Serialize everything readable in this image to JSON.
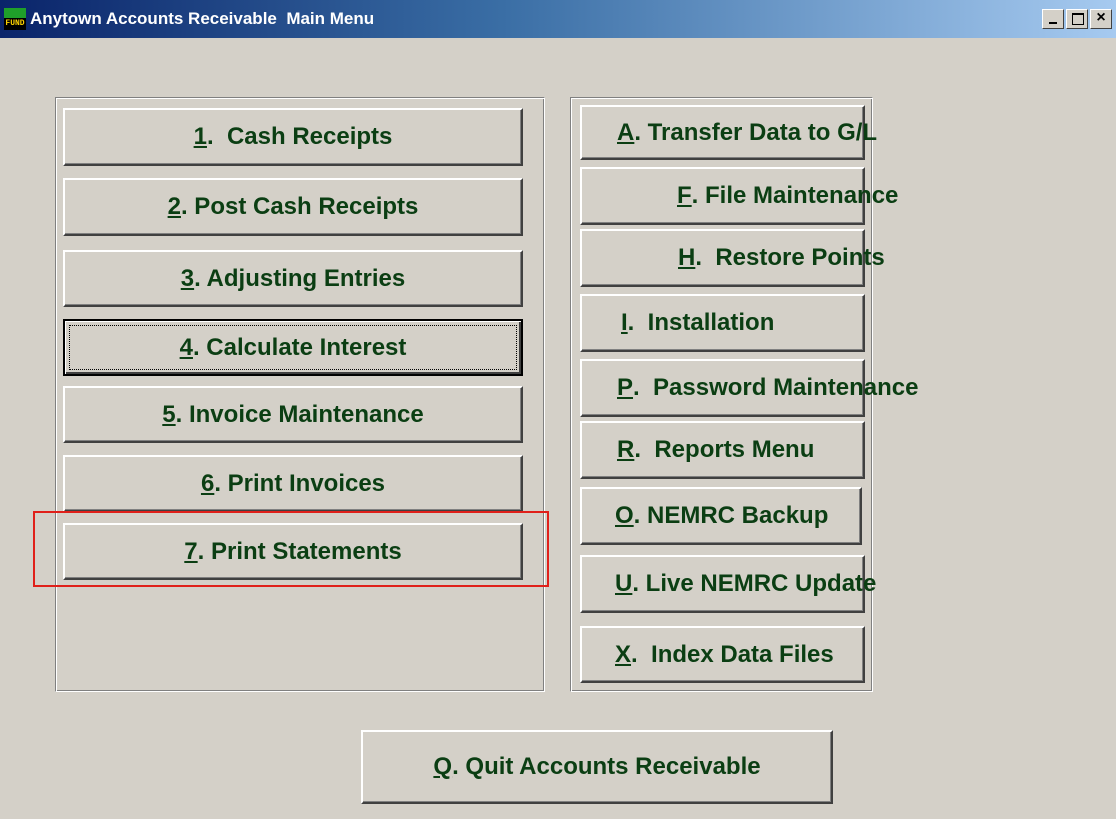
{
  "window": {
    "title": "Anytown Accounts Receivable  Main Menu",
    "icon_label": "FUND",
    "controls": [
      "minimize",
      "maximize",
      "close"
    ]
  },
  "left_menu": [
    {
      "key": "1",
      "rest": ".  Cash Receipts"
    },
    {
      "key": "2",
      "rest": ". Post Cash Receipts"
    },
    {
      "key": "3",
      "rest": ". Adjusting Entries"
    },
    {
      "key": "4",
      "rest": ". Calculate Interest",
      "focused": true
    },
    {
      "key": "5",
      "rest": ". Invoice Maintenance"
    },
    {
      "key": "6",
      "rest": ". Print Invoices"
    },
    {
      "key": "7",
      "rest": ". Print Statements",
      "highlighted": true
    }
  ],
  "right_menu": [
    {
      "key": "A",
      "rest": ". Transfer Data to G/L"
    },
    {
      "key": "F",
      "rest": ". File Maintenance"
    },
    {
      "key": "H",
      "rest": ".  Restore Points"
    },
    {
      "key": "I",
      "rest": ".  Installation"
    },
    {
      "key": "P",
      "rest": ".  Password Maintenance"
    },
    {
      "key": "R",
      "rest": ".  Reports Menu"
    },
    {
      "key": "O",
      "rest": ". NEMRC Backup"
    },
    {
      "key": "U",
      "rest": ". Live NEMRC Update"
    },
    {
      "key": "X",
      "rest": ".  Index Data Files"
    }
  ],
  "quit": {
    "key": "Q",
    "rest": ". Quit Accounts Receivable"
  },
  "colors": {
    "button_text": "#0b3e13",
    "face": "#d4d0c8",
    "highlight_box": "#e0201a",
    "title_gradient_start": "#0a246a"
  }
}
